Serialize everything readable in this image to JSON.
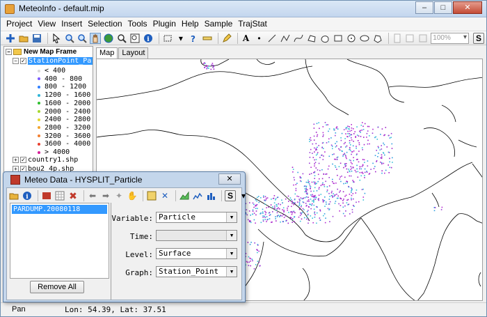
{
  "window": {
    "title": "MeteoInfo - default.mip",
    "min": "–",
    "max": "□",
    "close": "✕"
  },
  "menu": [
    "Project",
    "View",
    "Insert",
    "Selection",
    "Tools",
    "Plugin",
    "Help",
    "Sample",
    "TrajStat"
  ],
  "toolbar": {
    "zoom_placeholder": "100%"
  },
  "legend": {
    "frame": "New Map Frame",
    "layer": "StationPoint_Partic",
    "classes": [
      {
        "label": "< 400",
        "color": "#d8d8d8"
      },
      {
        "label": "400 - 800",
        "color": "#7b5cff"
      },
      {
        "label": "800 - 1200",
        "color": "#2f7fff"
      },
      {
        "label": "1200 - 1600",
        "color": "#2fb5d8"
      },
      {
        "label": "1600 - 2000",
        "color": "#2fbf2f"
      },
      {
        "label": "2000 - 2400",
        "color": "#a6d82f"
      },
      {
        "label": "2400 - 2800",
        "color": "#e4d62f"
      },
      {
        "label": "2800 - 3200",
        "color": "#f2a52f"
      },
      {
        "label": "3200 - 3600",
        "color": "#f27f2f"
      },
      {
        "label": "3600 - 4000",
        "color": "#e8402f"
      },
      {
        "label": "> 4000",
        "color": "#d81f9a"
      }
    ],
    "layers": [
      "country1.shp",
      "bou2_4p.shp"
    ]
  },
  "tabs": [
    "Map",
    "Layout"
  ],
  "status": {
    "mode": "Pan",
    "coords": "Lon: 54.39, Lat: 37.51"
  },
  "dialog": {
    "title": "Meteo Data - HYSPLIT_Particle",
    "close": "✕",
    "file": "PARDUMP.20080118",
    "remove_all": "Remove All",
    "variable_label": "Variable:",
    "variable_value": "Particle",
    "time_label": "Time:",
    "time_value": "",
    "level_label": "Level:",
    "level_value": "Surface",
    "graph_label": "Graph:",
    "graph_value": "Station_Point"
  }
}
